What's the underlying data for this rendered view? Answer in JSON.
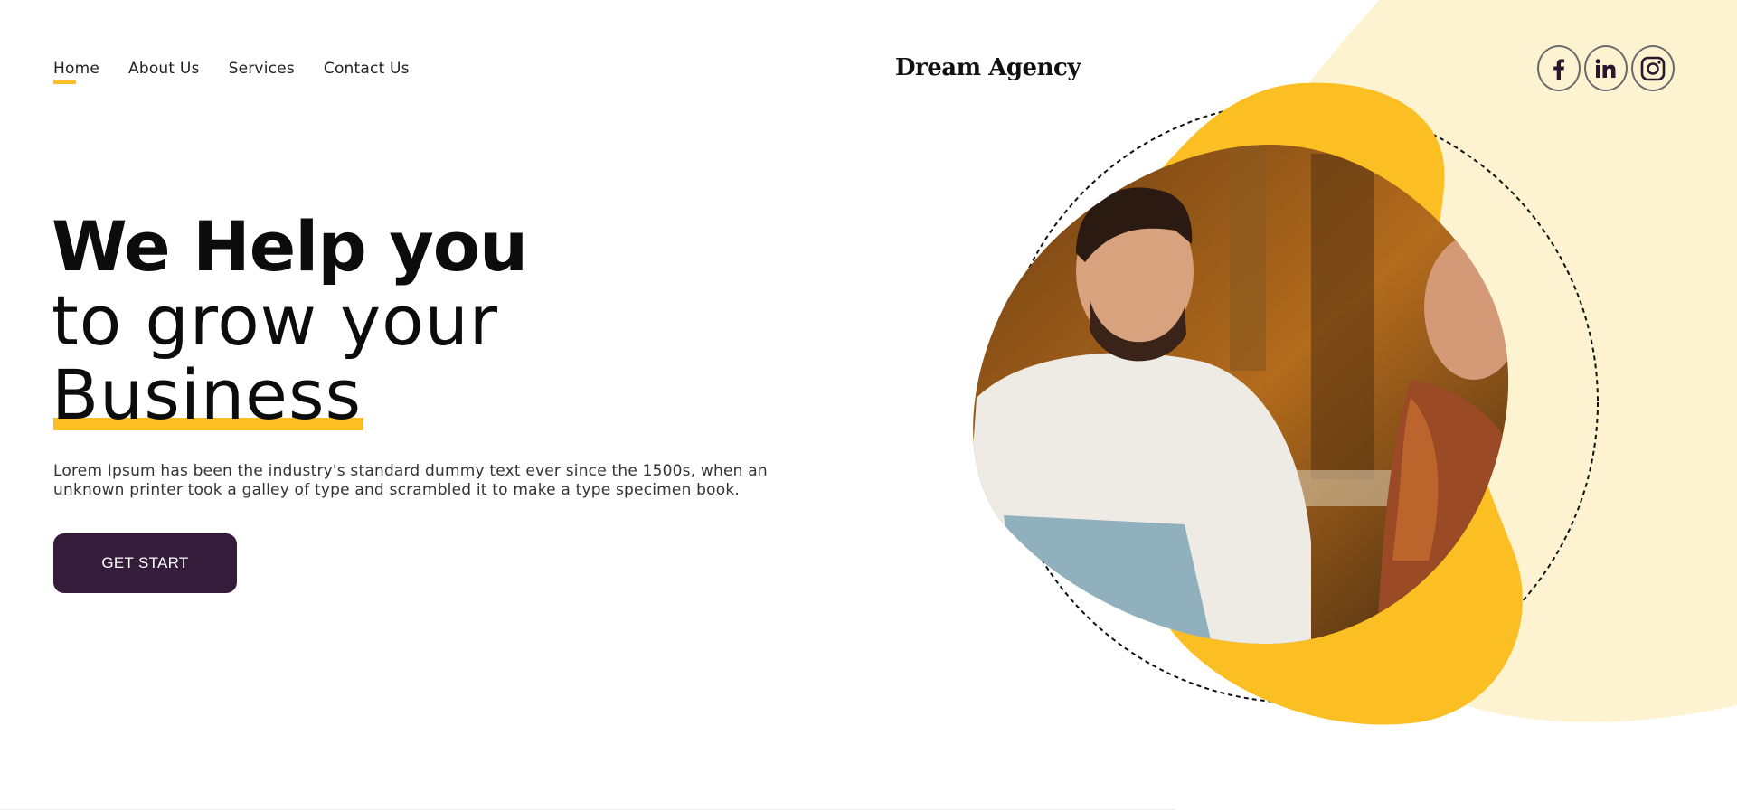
{
  "nav": {
    "items": [
      {
        "label": "Home",
        "active": true
      },
      {
        "label": "About Us",
        "active": false
      },
      {
        "label": "Services",
        "active": false
      },
      {
        "label": "Contact Us",
        "active": false
      }
    ]
  },
  "brand": {
    "name": "Dream Agency"
  },
  "social": [
    {
      "icon": "facebook-icon",
      "label": "f"
    },
    {
      "icon": "linkedin-icon",
      "label": "in"
    },
    {
      "icon": "instagram-icon",
      "label": ""
    }
  ],
  "hero": {
    "line1": "We Help you",
    "line2": "to grow your",
    "line3": "Business",
    "description": "Lorem Ipsum has been the industry's standard dummy text ever since the 1500s, when an unknown printer took a galley of type and scrambled it to make a type specimen book.",
    "cta_label": "GET START"
  },
  "colors": {
    "accent": "#fbbf24",
    "cream": "#fef3d0",
    "button": "#341c3a"
  }
}
